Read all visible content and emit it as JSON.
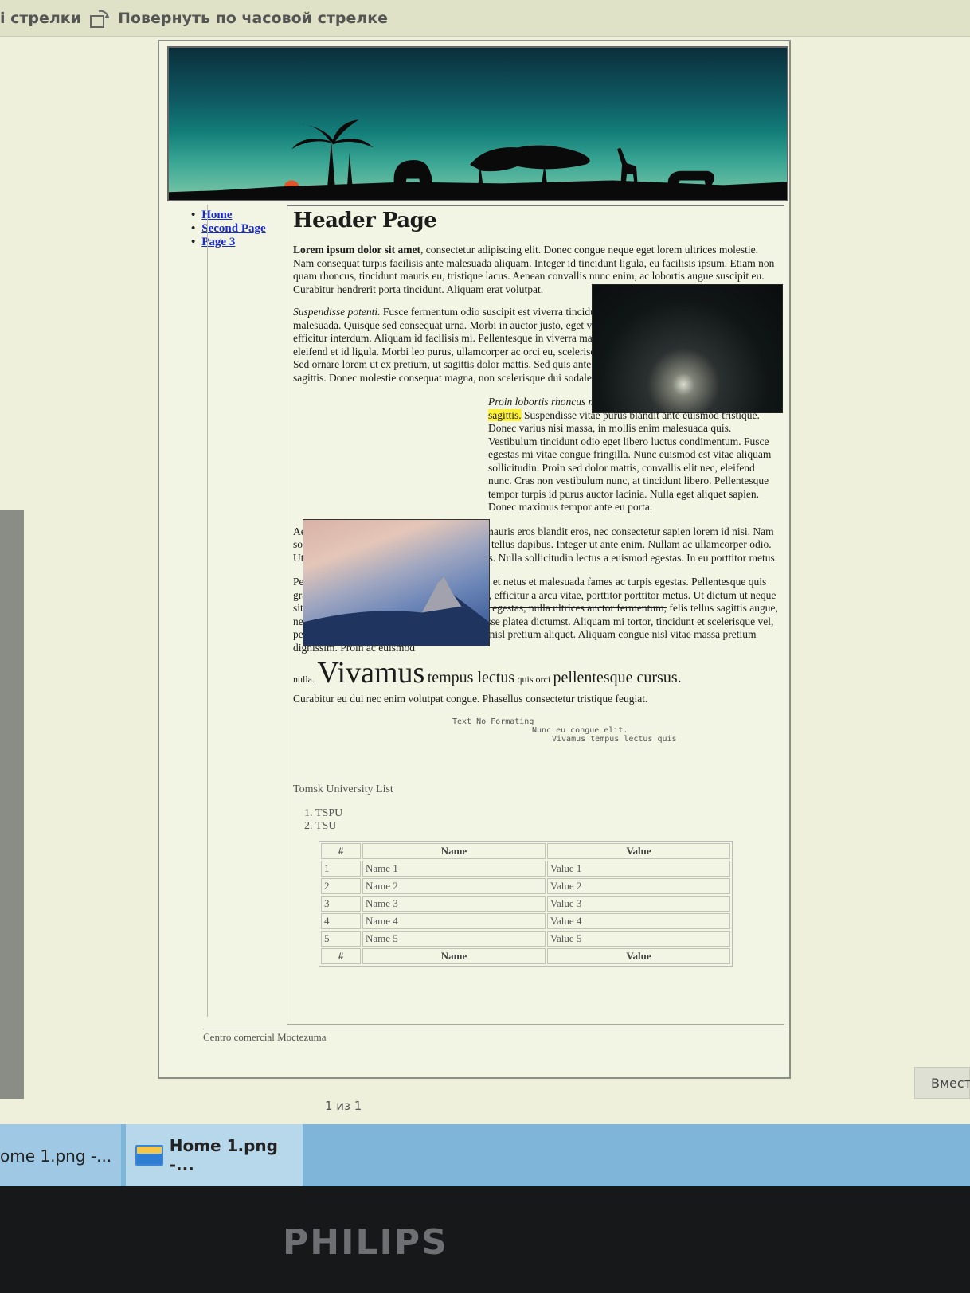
{
  "toolbar": {
    "left_text": "і стрелки",
    "rotate_label": "Повернуть по часовой стрелке",
    "rotate_icon": "rotate-clockwise-icon"
  },
  "page": {
    "nav": [
      "Home",
      "Second Page",
      "Page 3"
    ],
    "header": "Header Page",
    "p1_bold": "Lorem ipsum dolor sit amet",
    "p1_rest": ", consectetur adipiscing elit. Donec congue neque eget lorem ultrices molestie. Nam consequat turpis facilisis ante malesuada aliquam. Integer id tincidunt ligula, eu facilisis ipsum. Etiam non quam rhoncus, tincidunt mauris eu, tristique lacus. Aenean convallis nunc enim, ac lobortis augue suscipit eu. Curabitur hendrerit porta tincidunt. Aliquam erat volutpat.",
    "p2_italic": "Suspendisse potenti.",
    "p2_rest": " Fusce fermentum odio suscipit est viverra tincidunt. Quisque nec arcu eu quam fermentum malesuada. Quisque sed consequat urna. Morbi in auctor justo, eget varius arcu. Nullam sollicitudin id felis efficitur interdum. Aliquam id facilisis mi. Pellentesque in viverra magna. Vivamus vel tortor ac metus eleifend eleifend et id ligula. Morbi leo purus, ullamcorper ac orci eu, scelerisque hendrerit lorem. Sed eu finibus orci. Sed ornare lorem ut ex pretium, ut sagittis dolor mattis. Sed quis ante augue. Donec in orci et diam faucibus sagittis. Donec molestie consequat magna, non scelerisque dui sodales id.",
    "p3_italic": "Proin lobortis rhoncus molestie.",
    "p3_highlight": "Proin viverra tortor vel egestas sagittis.",
    "p3_rest": " Suspendisse vitae purus blandit ante euismod tristique. Donec varius nisi massa, in mollis enim malesuada quis. Vestibulum tincidunt odio eget libero luctus condimentum. Fusce egestas mi vitae congue fringilla. Nunc euismod est vitae aliquam sollicitudin. Proin sed dolor mattis, convallis elit nec, eleifend nunc. Cras non vestibulum nunc, at tincidunt libero. Pellentesque tempor turpis id purus auctor lacinia. Nulla eget aliquet sapien. Donec maximus tempor ante eu porta.",
    "p4": "Aenean lacinia, risus eu scelerisque tempus, mauris eros blandit eros, nec consectetur sapien lorem id nisi. Nam sollicitudin elit id nibh venenatis, vitae luctus tellus dapibus. Integer ut ante enim. Nullam ac ullamcorper odio. Ut dignissim tempor sapien, vitae luctus purus. Nulla sollicitudin lectus a euismod egestas. In eu porttitor metus.",
    "p5_a": "Pellentesque habitant morbi tristique senectus et netus et malesuada fames ac turpis egestas. Pellentesque quis gravida est. Nunc eu congue elit. In quam dui, efficitur a arcu vitae, porttitor porttitor metus. Ut dictum ut neque sit amet tincidunt. Sed sit amet magna nisi.",
    "p5_strike": "In egestas, nulla ultrices auctor fermentum,",
    "p5_b": " felis tellus sagittis augue, nec aliquam nibh nulla eu urna. In hac habitasse platea dictumst. Aliquam mi tortor, tincidunt et scelerisque vel, pellentesque non dui. Donec posuere lorem a nisl pretium aliquet. Aliquam congue nisl vitae massa pretium dignissim. Proin ac euismod",
    "p6_small": "nulla.",
    "p6_big": "Vivamus",
    "p6_med1": "tempus lectus",
    "p6_small2": "quis orci",
    "p6_med2": "pellentesque cursus.",
    "p6_line2": "Curabitur eu dui nec enim volutpat congue. Phasellus consectetur tristique feugiat.",
    "pre1": "Text No Formating",
    "pre2": "Nunc eu congue elit.",
    "pre3": "Vivamus tempus lectus quis",
    "list_title": "Tomsk University List",
    "list": [
      "TSPU",
      "TSU"
    ],
    "table": {
      "headers": [
        "#",
        "Name",
        "Value"
      ],
      "rows": [
        [
          "1",
          "Name 1",
          "Value 1"
        ],
        [
          "2",
          "Name 2",
          "Value 2"
        ],
        [
          "3",
          "Name 3",
          "Value 3"
        ],
        [
          "4",
          "Name 4",
          "Value 4"
        ],
        [
          "5",
          "Name 5",
          "Value 5"
        ]
      ],
      "footer": [
        "#",
        "Name",
        "Value"
      ]
    },
    "footer": "Centro comercial Moctezuma"
  },
  "viewer": {
    "page_count": "1 из 1",
    "side_button": "Вмест"
  },
  "taskbar": {
    "item1": "ome 1.png -...",
    "item2": "Home 1.png -...",
    "item2_icon": "photos-app-icon"
  },
  "monitor": {
    "brand": "PHILIPS"
  }
}
